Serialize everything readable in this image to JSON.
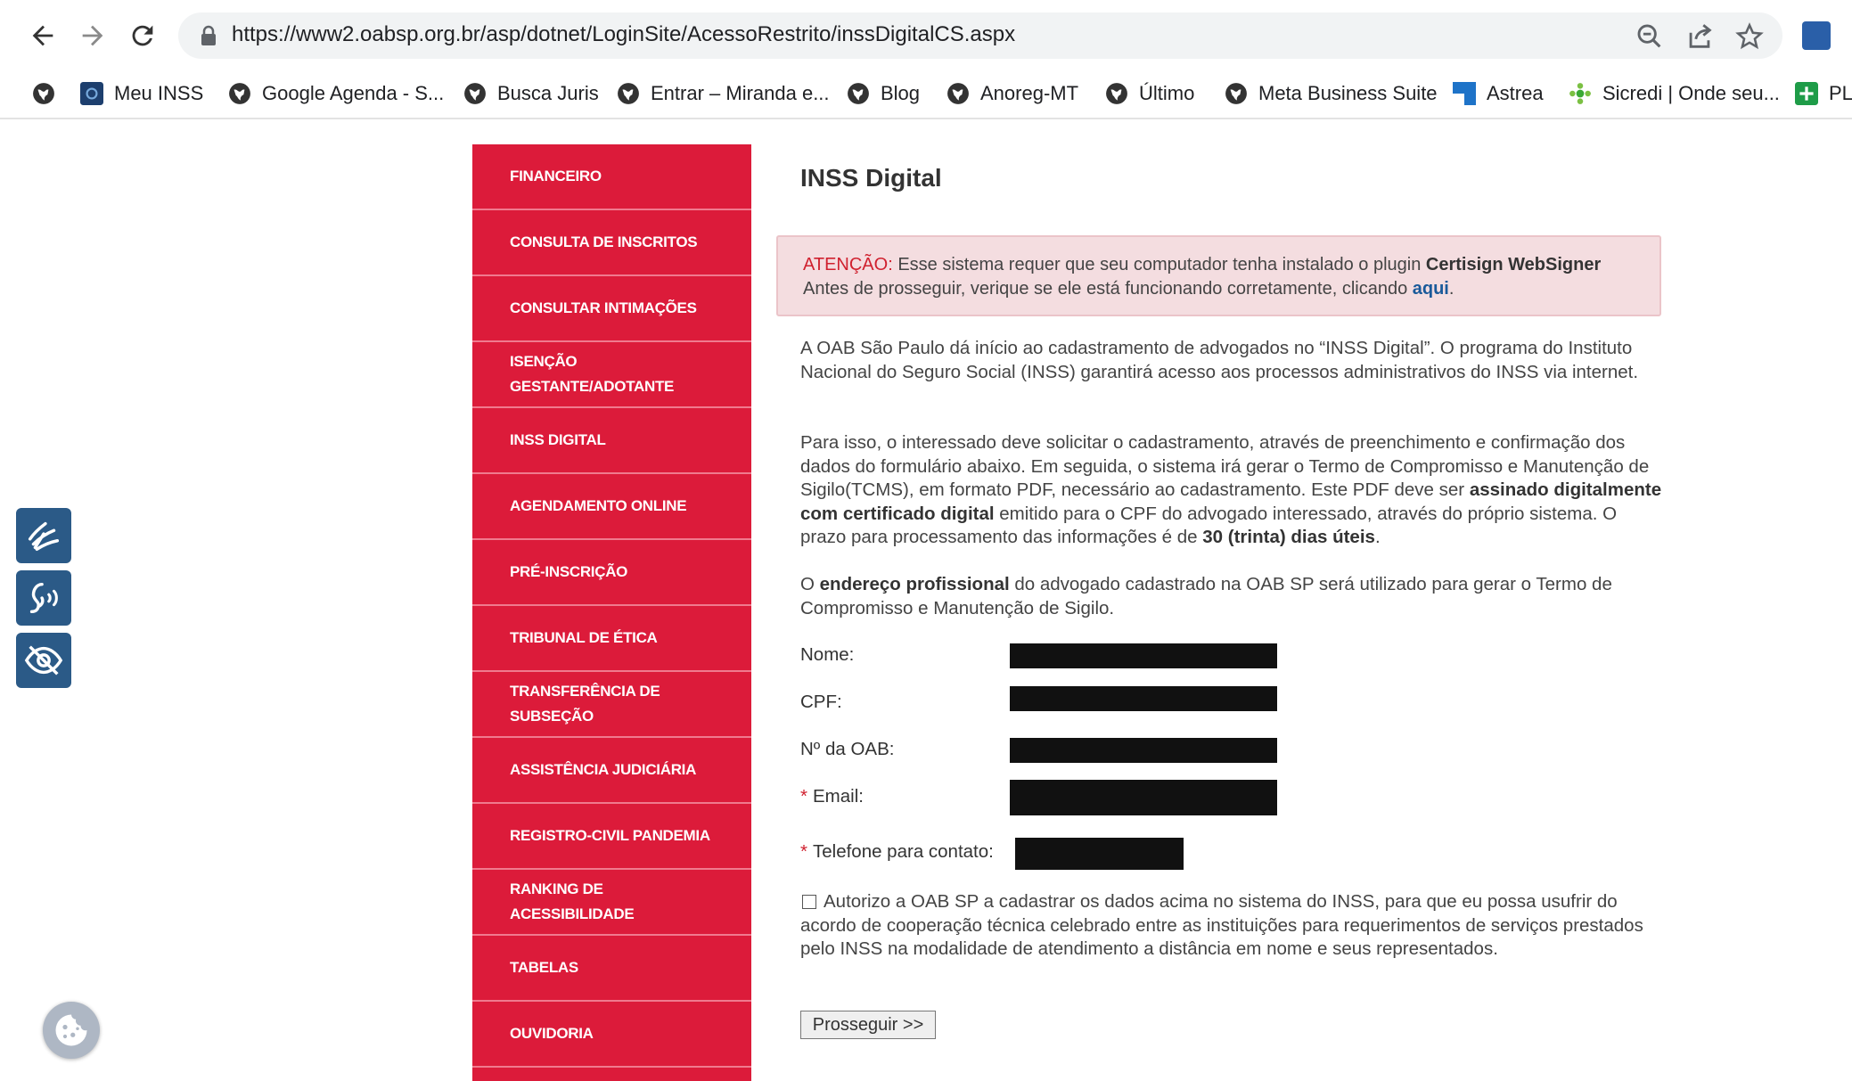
{
  "browser": {
    "url": "https://www2.oabsp.org.br/asp/dotnet/LoginSite/AcessoRestrito/inssDigitalCS.aspx",
    "bookmarks": [
      {
        "label": ""
      },
      {
        "label": "Meu INSS"
      },
      {
        "label": "Google Agenda - S..."
      },
      {
        "label": "Busca Juris"
      },
      {
        "label": "Entrar – Miranda e..."
      },
      {
        "label": "Blog"
      },
      {
        "label": "Anoreg-MT"
      },
      {
        "label": "Último"
      },
      {
        "label": "Meta Business Suite"
      },
      {
        "label": "Astrea"
      },
      {
        "label": "Sicredi | Onde seu..."
      },
      {
        "label": "PL"
      }
    ]
  },
  "menu": {
    "items": [
      {
        "label": "FINANCEIRO"
      },
      {
        "label": "CONSULTA DE INSCRITOS"
      },
      {
        "label": "CONSULTAR INTIMAÇÕES"
      },
      {
        "label": "ISENÇÃO",
        "label2": "GESTANTE/ADOTANTE"
      },
      {
        "label": "INSS DIGITAL"
      },
      {
        "label": "AGENDAMENTO ONLINE"
      },
      {
        "label": "PRÉ-INSCRIÇÃO"
      },
      {
        "label": "TRIBUNAL DE ÉTICA"
      },
      {
        "label": "TRANSFERÊNCIA DE",
        "label2": "SUBSEÇÃO"
      },
      {
        "label": "ASSISTÊNCIA JUDICIÁRIA"
      },
      {
        "label": "REGISTRO-CIVIL PANDEMIA"
      },
      {
        "label": "RANKING DE",
        "label2": "ACESSIBILIDADE"
      },
      {
        "label": "TABELAS"
      },
      {
        "label": "OUVIDORIA"
      }
    ]
  },
  "content": {
    "title": "INSS Digital",
    "alert": {
      "attention": "ATENÇÃO:",
      "line1": " Esse sistema requer que seu computador tenha instalado o plugin ",
      "plugin": "Certisign WebSigner",
      "line2": "Antes de prosseguir, verique se ele está funcionando corretamente, clicando ",
      "link": "aqui",
      "end": "."
    },
    "para1": "A OAB São Paulo dá início ao cadastramento de advogados no “INSS Digital”. O programa do Instituto Nacional do Seguro Social (INSS) garantirá acesso aos processos administrativos do INSS via internet.",
    "para2": {
      "a": "Para isso, o interessado deve solicitar o cadastramento, através de preenchimento e confirmação dos dados do formulário abaixo. Em seguida, o sistema irá gerar o Termo de Compromisso e Manutenção de Sigilo(TCMS), em formato PDF, necessário ao cadastramento. Este PDF deve ser ",
      "b": "assinado digitalmente com certificado digital",
      "c": " emitido para o CPF do advogado interessado, através do próprio sistema. O prazo para processamento das informações é de ",
      "d": "30 (trinta) dias úteis",
      "e": "."
    },
    "para3": {
      "a": "O ",
      "b": "endereço profissional",
      "c": " do advogado cadastrado na OAB SP será utilizado para gerar o Termo de Compromisso e Manutenção de Sigilo."
    },
    "form": {
      "nome_label": "Nome:",
      "cpf_label": "CPF:",
      "oab_label": "Nº da OAB:",
      "email_label": "Email:",
      "phone_label": "Telefone para contato:",
      "required_mark": "*"
    },
    "consent": "Autorizo a OAB SP a cadastrar os dados acima no sistema do INSS, para que eu possa usufrir do acordo de cooperação técnica celebrado entre as instituições para requerimentos de serviços prestados pelo INSS na modalidade de atendimento a distância em nome e seus representados.",
    "submit": "Prosseguir >>"
  },
  "colors": {
    "menu_bg": "#dc1b3a",
    "alert_bg": "#f4dde0",
    "accessibility_bg": "#2b5a87"
  },
  "icons": [
    "back-arrow-icon",
    "forward-arrow-icon",
    "reload-icon",
    "lock-icon",
    "zoom-icon",
    "share-icon",
    "star-icon",
    "sign-language-icon",
    "audio-reader-icon",
    "eye-hidden-icon",
    "cookie-icon"
  ]
}
